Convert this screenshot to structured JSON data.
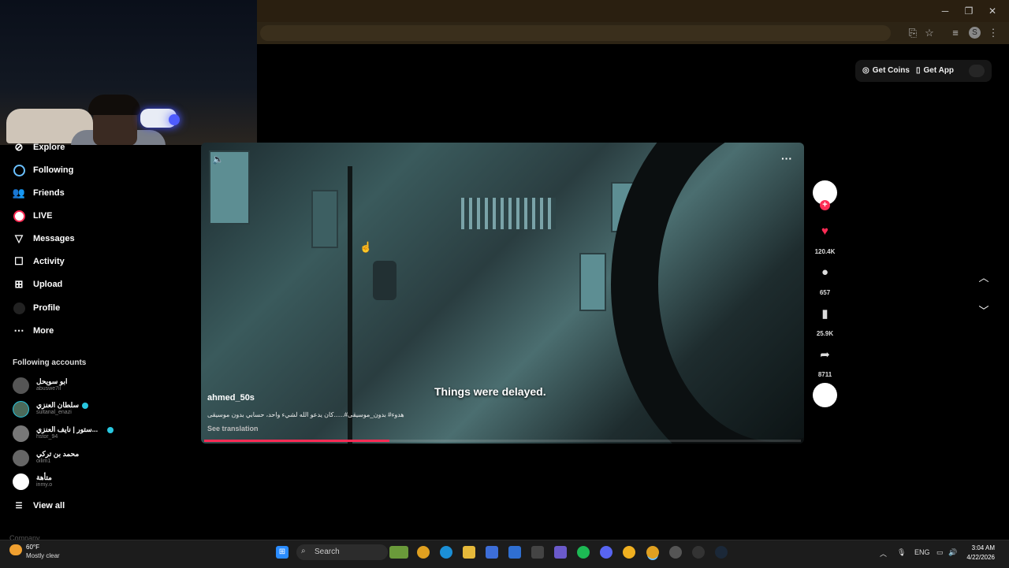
{
  "browser": {
    "profile_initial": "S"
  },
  "header": {
    "get_coins": "Get Coins",
    "get_app": "Get App"
  },
  "sidebar": {
    "items": [
      {
        "label": "Explore",
        "icon": "compass-icon"
      },
      {
        "label": "Following",
        "icon": "following-ring-icon"
      },
      {
        "label": "Friends",
        "icon": "friends-icon"
      },
      {
        "label": "LIVE",
        "icon": "live-ring-icon"
      },
      {
        "label": "Messages",
        "icon": "messages-icon"
      },
      {
        "label": "Activity",
        "icon": "activity-icon"
      },
      {
        "label": "Upload",
        "icon": "upload-icon"
      },
      {
        "label": "Profile",
        "icon": "profile-avatar-icon"
      },
      {
        "label": "More",
        "icon": "more-icon"
      }
    ],
    "following_title": "Following accounts",
    "accounts": [
      {
        "name": "ابو سويحل",
        "username": "abuswe7il",
        "verified": false
      },
      {
        "name": "سلطان العنزي",
        "username": "sultanal_enazi",
        "verified": true
      },
      {
        "name": "ستور | نايف العنزي...",
        "username": "hstor_94",
        "verified": true
      },
      {
        "name": "محمد بن تركي",
        "username": "oilim1",
        "verified": false
      },
      {
        "name": "متأهة",
        "username": "inmy.o",
        "verified": false
      }
    ],
    "view_all": "View all",
    "footer": "Company"
  },
  "video": {
    "caption": "Things were delayed.",
    "author": "ahmed_50s",
    "description": "هدوء# بدون_موسيقى#......كان يدعو الله لشيء واحد، حسابي بدون موسيقى",
    "see_translation": "See translation",
    "progress": 0.31
  },
  "actions": {
    "likes": "120.4K",
    "comments": "657",
    "bookmarks": "25.9K",
    "shares": "8711"
  },
  "taskbar": {
    "temperature": "60°F",
    "weather": "Mostly clear",
    "search": "Search",
    "language": "ENG",
    "time": "3:04 AM",
    "date": "4/22/2026"
  },
  "colors": {
    "accent": "#fe2c55",
    "verified": "#28c7e0"
  }
}
